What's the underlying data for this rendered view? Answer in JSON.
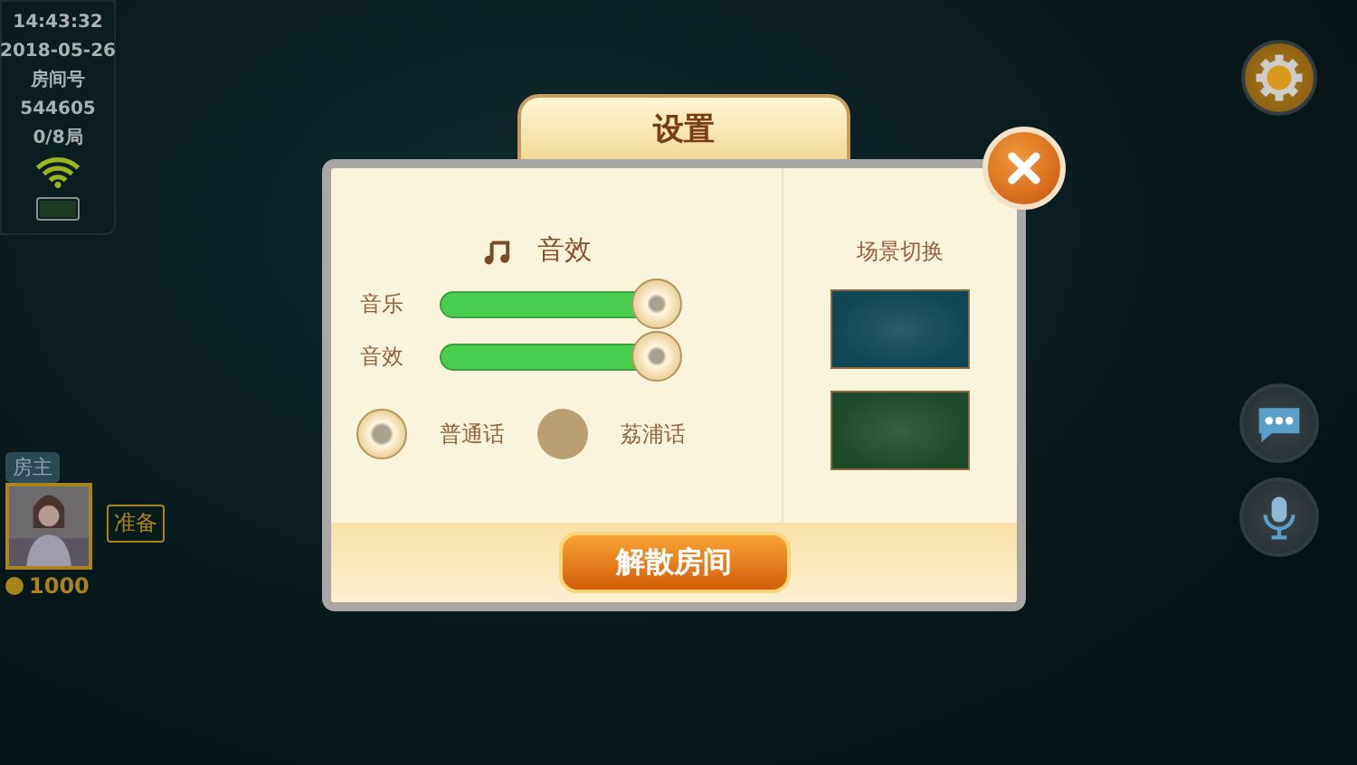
{
  "status": {
    "time": "14:43:32",
    "date": "2018-05-26",
    "room_label": "房间号",
    "room_number": "544605",
    "rounds": "0/8局"
  },
  "player": {
    "role": "房主",
    "ready": "准备",
    "coins": "1000"
  },
  "dialog": {
    "title": "设置",
    "sound_heading": "音效",
    "sliders": [
      {
        "label": "音乐",
        "level": 1
      },
      {
        "label": "音效",
        "level": 1
      }
    ],
    "dialects": [
      {
        "label": "普通话",
        "selected": true
      },
      {
        "label": "荔浦话",
        "selected": false
      }
    ],
    "scene_heading": "场景切换",
    "scenes": [
      {
        "color": "#0f4656"
      },
      {
        "color": "#1d4a2a"
      }
    ],
    "dismiss_button": "解散房间"
  }
}
